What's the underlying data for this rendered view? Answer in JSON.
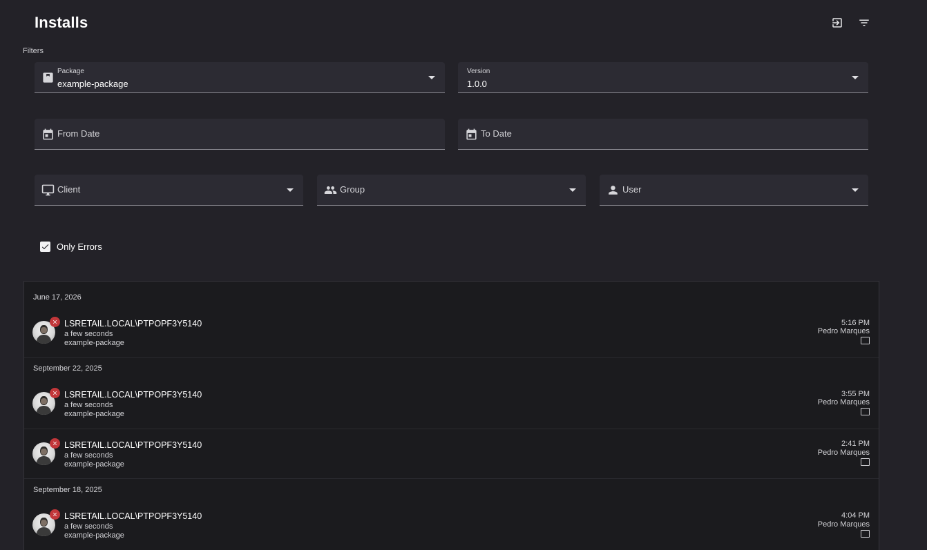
{
  "header": {
    "title": "Installs",
    "export_icon": "export-icon",
    "filter_icon": "filter-list-icon"
  },
  "filters": {
    "section_label": "Filters",
    "package": {
      "label": "Package",
      "value": "example-package",
      "icon": "package-icon"
    },
    "version": {
      "label": "Version",
      "value": "1.0.0"
    },
    "from_date": {
      "placeholder": "From Date",
      "icon": "calendar-icon"
    },
    "to_date": {
      "placeholder": "To Date",
      "icon": "calendar-icon"
    },
    "client": {
      "placeholder": "Client",
      "icon": "monitor-icon"
    },
    "group": {
      "placeholder": "Group",
      "icon": "group-icon"
    },
    "user": {
      "placeholder": "User",
      "icon": "person-icon"
    },
    "only_errors": {
      "label": "Only Errors",
      "checked": true
    }
  },
  "install_groups": [
    {
      "date": "June 17, 2026",
      "entries": [
        {
          "machine": "LSRETAIL.LOCAL\\PTPOPF3Y5140",
          "ago": "a few seconds",
          "package": "example-package",
          "time": "5:16 PM",
          "user": "Pedro Marques",
          "status": "error"
        }
      ]
    },
    {
      "date": "September 22, 2025",
      "entries": [
        {
          "machine": "LSRETAIL.LOCAL\\PTPOPF3Y5140",
          "ago": "a few seconds",
          "package": "example-package",
          "time": "3:55 PM",
          "user": "Pedro Marques",
          "status": "error"
        },
        {
          "machine": "LSRETAIL.LOCAL\\PTPOPF3Y5140",
          "ago": "a few seconds",
          "package": "example-package",
          "time": "2:41 PM",
          "user": "Pedro Marques",
          "status": "error"
        }
      ]
    },
    {
      "date": "September 18, 2025",
      "entries": [
        {
          "machine": "LSRETAIL.LOCAL\\PTPOPF3Y5140",
          "ago": "a few seconds",
          "package": "example-package",
          "time": "4:04 PM",
          "user": "Pedro Marques",
          "status": "error"
        }
      ]
    }
  ],
  "colors": {
    "background": "#232228",
    "field_background": "#2c2b33",
    "list_background": "#1b1b1e",
    "error": "#c2373a"
  }
}
